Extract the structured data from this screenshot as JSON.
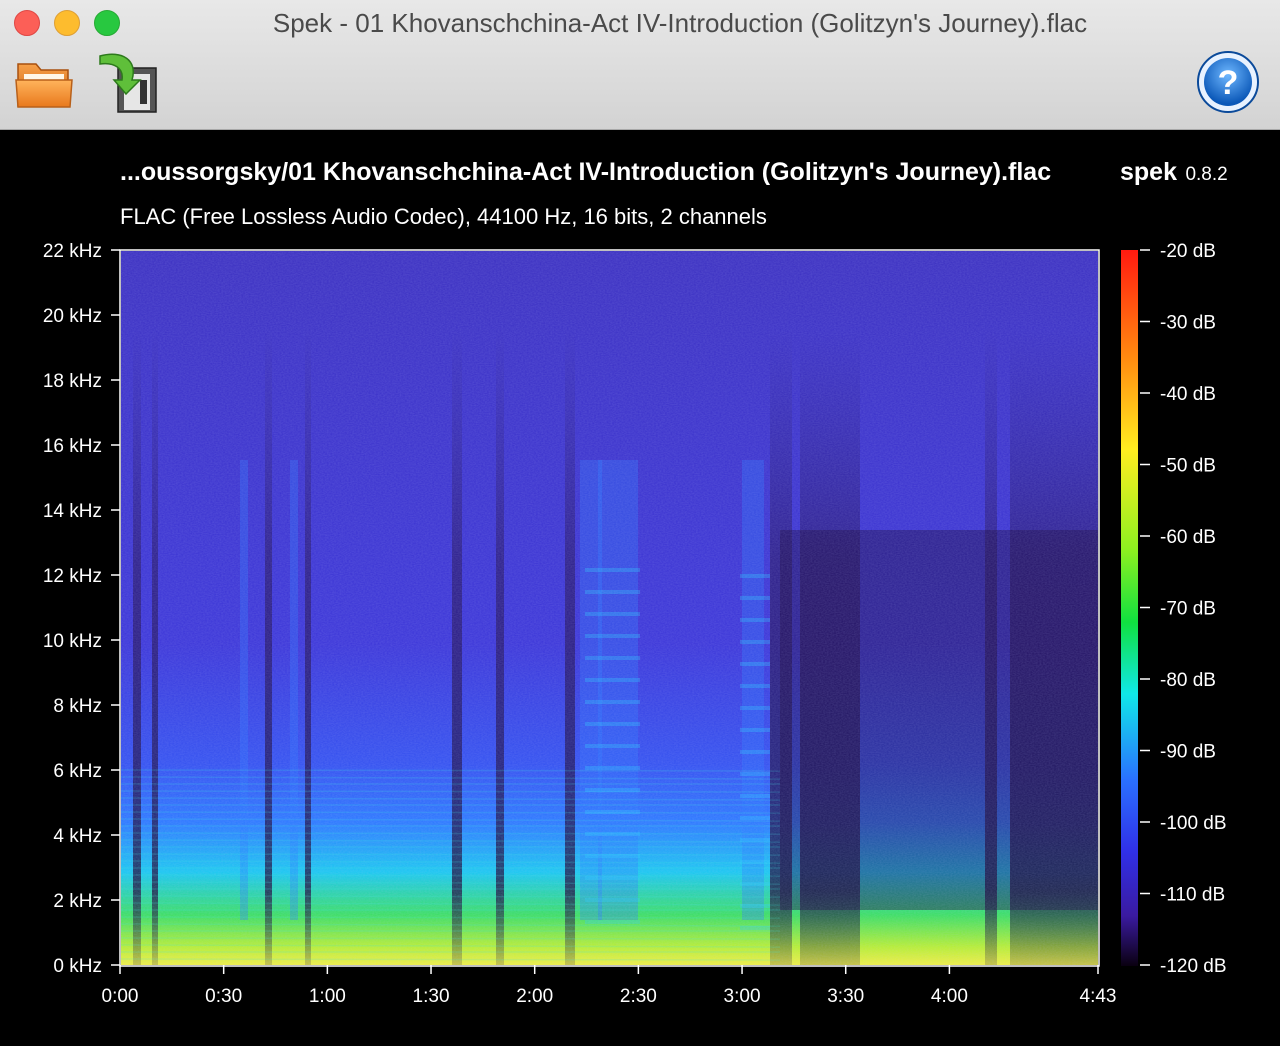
{
  "window": {
    "title": "Spek - 01 Khovanschchina-Act IV-Introduction (Golitzyn's Journey).flac"
  },
  "toolbar": {
    "open_icon": "folder-icon",
    "save_icon": "save-export-icon",
    "help_icon": "help-icon"
  },
  "header": {
    "file_path": "...oussorgsky/01 Khovanschchina-Act IV-Introduction (Golitzyn's Journey).flac",
    "app_name": "spek",
    "app_version": "0.8.2",
    "file_info": "FLAC (Free Lossless Audio Codec), 44100 Hz, 16 bits, 2 channels"
  },
  "colors": {
    "background": "#000000",
    "spectrum_low": "#1a0033",
    "spectrum_mid": "#3a3ad8",
    "spectrum_high": "#ff2a10"
  },
  "chart_data": {
    "type": "heatmap",
    "title": "",
    "xlabel": "",
    "ylabel": "",
    "x_ticks": [
      "0:00",
      "0:30",
      "1:00",
      "1:30",
      "2:00",
      "2:30",
      "3:00",
      "3:30",
      "4:00",
      "4:43"
    ],
    "x_tick_seconds": [
      0,
      30,
      60,
      90,
      120,
      150,
      180,
      210,
      240,
      283
    ],
    "xlim": [
      0,
      283
    ],
    "y_ticks": [
      "0 kHz",
      "2 kHz",
      "4 kHz",
      "6 kHz",
      "8 kHz",
      "10 kHz",
      "12 kHz",
      "14 kHz",
      "16 kHz",
      "18 kHz",
      "20 kHz",
      "22 kHz"
    ],
    "y_tick_khz": [
      0,
      2,
      4,
      6,
      8,
      10,
      12,
      14,
      16,
      18,
      20,
      22
    ],
    "ylim": [
      0,
      22
    ],
    "colorbar_ticks": [
      "-20 dB",
      "-30 dB",
      "-40 dB",
      "-50 dB",
      "-60 dB",
      "-70 dB",
      "-80 dB",
      "-90 dB",
      "-100 dB",
      "-110 dB",
      "-120 dB"
    ],
    "colorbar_db": [
      -20,
      -30,
      -40,
      -50,
      -60,
      -70,
      -80,
      -90,
      -100,
      -110,
      -120
    ],
    "colorbar_range": [
      -120,
      -20
    ]
  }
}
